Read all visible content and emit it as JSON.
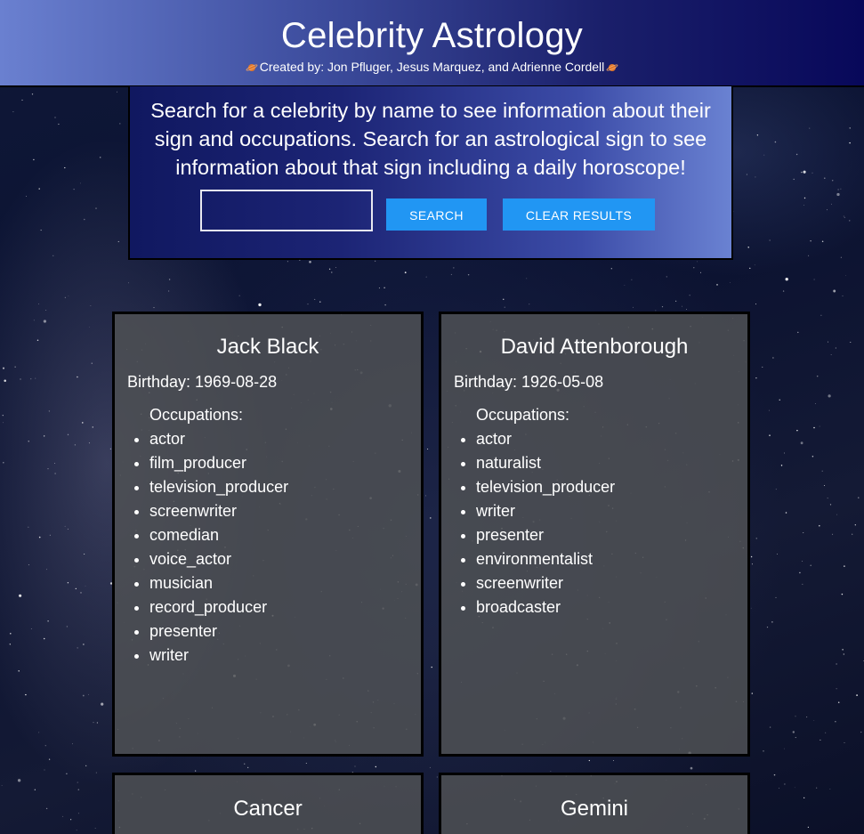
{
  "header": {
    "title": "Celebrity Astrology",
    "credits": "Created by: Jon Pfluger, Jesus Marquez, and Adrienne Cordell",
    "credit_icon": "ringed-planet-icon"
  },
  "search": {
    "description": "Search for a celebrity by name to see information about their sign and occupations. Search for an astrological sign to see information about that sign including a daily horoscope!",
    "input_value": "",
    "search_label": "SEARCH",
    "clear_label": "CLEAR RESULTS",
    "button_color": "#2196f3"
  },
  "celebrities": [
    {
      "name": "Jack Black",
      "birthday": "Birthday: 1969-08-28",
      "occupations_label": "Occupations:",
      "occupations": [
        "actor",
        "film_producer",
        "television_producer",
        "screenwriter",
        "comedian",
        "voice_actor",
        "musician",
        "record_producer",
        "presenter",
        "writer"
      ]
    },
    {
      "name": "David Attenborough",
      "birthday": "Birthday: 1926-05-08",
      "occupations_label": "Occupations:",
      "occupations": [
        "actor",
        "naturalist",
        "television_producer",
        "writer",
        "presenter",
        "environmentalist",
        "screenwriter",
        "broadcaster"
      ]
    }
  ],
  "signs": [
    {
      "name": "Cancer"
    },
    {
      "name": "Gemini"
    }
  ]
}
